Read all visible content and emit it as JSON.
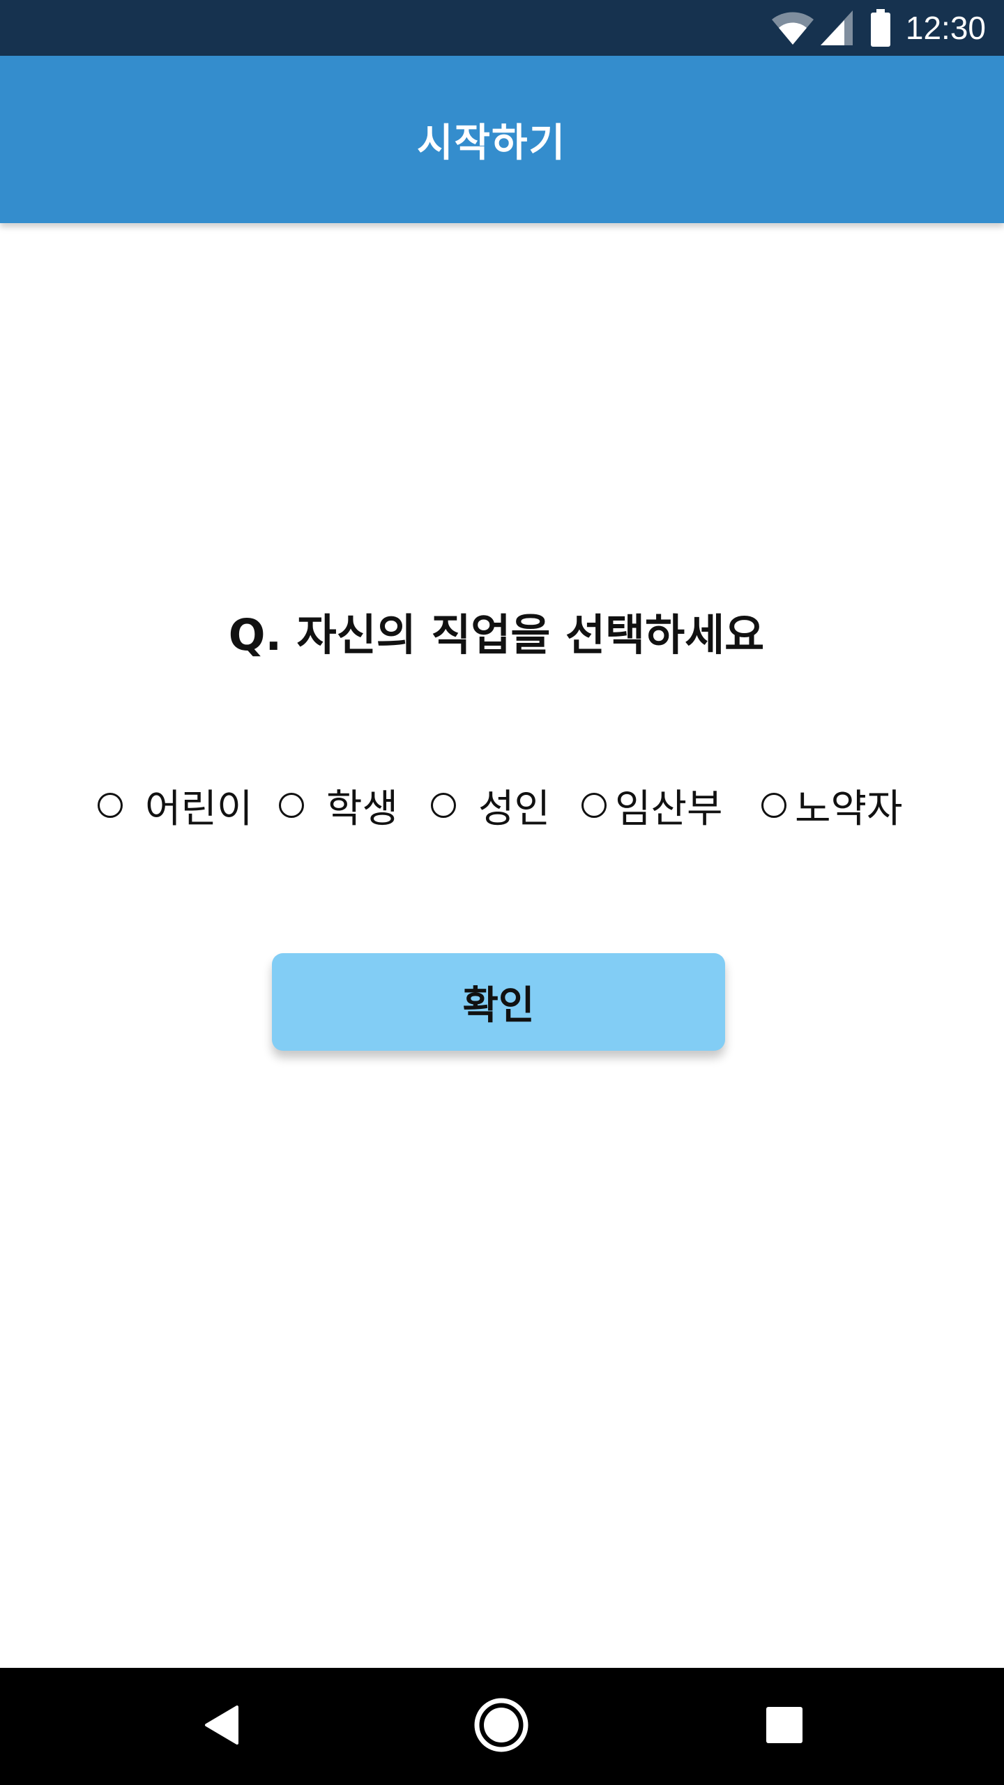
{
  "status_bar": {
    "time": "12:30",
    "icons": [
      "wifi-icon",
      "cell-signal-icon",
      "battery-icon"
    ],
    "background": "#16324f"
  },
  "app_bar": {
    "title": "시작하기",
    "background": "#348dcd"
  },
  "question": {
    "text": "Q. 자신의 직업을 선택하세요"
  },
  "options": [
    {
      "label": "어린이",
      "selected": false
    },
    {
      "label": "학생",
      "selected": false
    },
    {
      "label": "성인",
      "selected": false
    },
    {
      "label": "임산부",
      "selected": false
    },
    {
      "label": "노약자",
      "selected": false
    }
  ],
  "confirm_button": {
    "label": "확인",
    "background": "#82cdf5"
  },
  "nav_bar": {
    "buttons": [
      "back-icon",
      "home-icon",
      "recents-icon"
    ],
    "background": "#000000"
  }
}
